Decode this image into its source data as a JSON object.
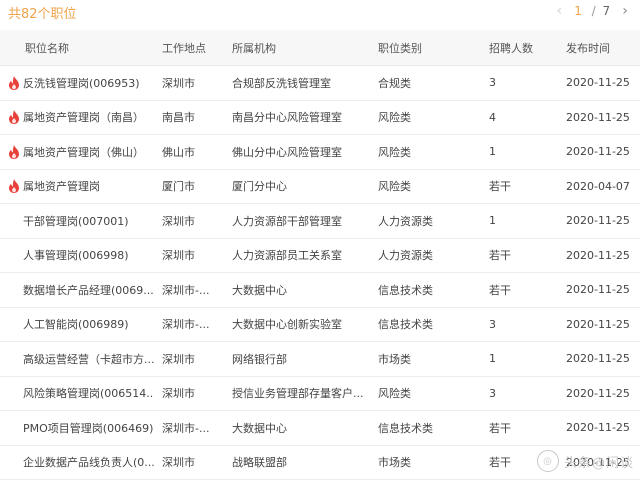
{
  "summary": {
    "total_text": "共82个职位"
  },
  "pagination": {
    "current": "1",
    "separator": "/",
    "total": "7",
    "prev_icon": "chevron-left-icon",
    "next_icon": "chevron-right-icon"
  },
  "table": {
    "headers": {
      "name": "职位名称",
      "location": "工作地点",
      "org": "所属机构",
      "category": "职位类别",
      "count": "招聘人数",
      "date": "发布时间"
    },
    "rows": [
      {
        "hot": true,
        "name": "反洗钱管理岗(006953)",
        "location": "深圳市",
        "org": "合规部反洗钱管理室",
        "category": "合规类",
        "count": "3",
        "date": "2020-11-25"
      },
      {
        "hot": true,
        "name": "属地资产管理岗（南昌）",
        "location": "南昌市",
        "org": "南昌分中心风险管理室",
        "category": "风险类",
        "count": "4",
        "date": "2020-11-25"
      },
      {
        "hot": true,
        "name": "属地资产管理岗（佛山）",
        "location": "佛山市",
        "org": "佛山分中心风险管理室",
        "category": "风险类",
        "count": "1",
        "date": "2020-11-25"
      },
      {
        "hot": true,
        "name": "属地资产管理岗",
        "location": "厦门市",
        "org": "厦门分中心",
        "category": "风险类",
        "count": "若干",
        "date": "2020-04-07"
      },
      {
        "hot": false,
        "name": "干部管理岗(007001)",
        "location": "深圳市",
        "org": "人力资源部干部管理室",
        "category": "人力资源类",
        "count": "1",
        "date": "2020-11-25"
      },
      {
        "hot": false,
        "name": "人事管理岗(006998)",
        "location": "深圳市",
        "org": "人力资源部员工关系室",
        "category": "人力资源类",
        "count": "若干",
        "date": "2020-11-25"
      },
      {
        "hot": false,
        "name": "数据增长产品经理(0069...",
        "location": "深圳市-...",
        "org": "大数据中心",
        "category": "信息技术类",
        "count": "若干",
        "date": "2020-11-25"
      },
      {
        "hot": false,
        "name": "人工智能岗(006989)",
        "location": "深圳市-...",
        "org": "大数据中心创新实验室",
        "category": "信息技术类",
        "count": "3",
        "date": "2020-11-25"
      },
      {
        "hot": false,
        "name": "高级运营经营（卡超市方...",
        "location": "深圳市",
        "org": "网络银行部",
        "category": "市场类",
        "count": "1",
        "date": "2020-11-25"
      },
      {
        "hot": false,
        "name": "风险策略管理岗(006514...",
        "location": "深圳市",
        "org": "授信业务管理部存量客户...",
        "category": "风险类",
        "count": "3",
        "date": "2020-11-25"
      },
      {
        "hot": false,
        "name": "PMO项目管理岗(006469)",
        "location": "深圳市-...",
        "org": "大数据中心",
        "category": "信息技术类",
        "count": "若干",
        "date": "2020-11-25"
      },
      {
        "hot": false,
        "name": "企业数据产品线负责人(0...",
        "location": "深圳市",
        "org": "战略联盟部",
        "category": "市场类",
        "count": "若干",
        "date": "2020-11-25"
      }
    ]
  },
  "watermark": {
    "text": "头条@闲谈"
  },
  "colors": {
    "accent": "#f0a24b",
    "hot_icon": "#e8413a"
  }
}
